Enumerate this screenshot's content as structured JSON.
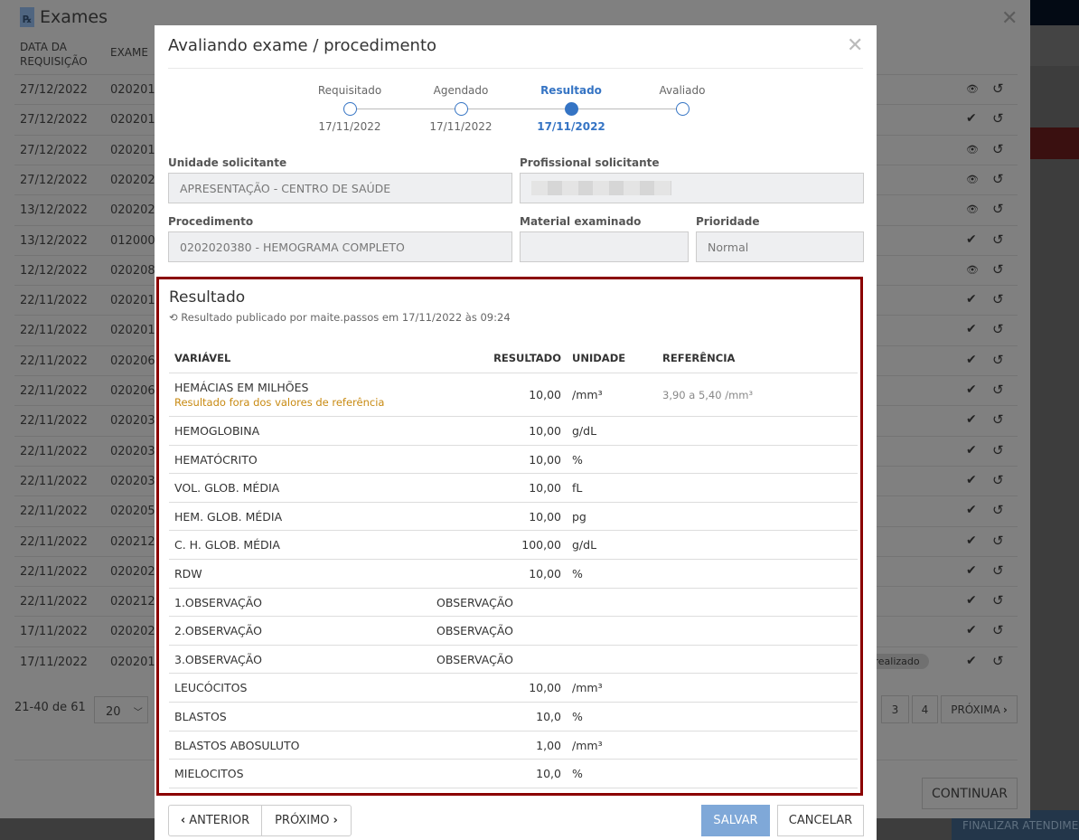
{
  "background": {
    "finalizar_label": "FINALIZAR ATENDIMENTO"
  },
  "exames": {
    "title": "Exames",
    "columns": [
      "DATA DA REQUISIÇÃO",
      "EXAME"
    ],
    "col_date_line1": "DATA DA",
    "col_date_line2": "REQUISIÇÃO",
    "rows": [
      {
        "date": "27/12/2022",
        "code": "020201",
        "action": "eye-icon"
      },
      {
        "date": "27/12/2022",
        "code": "020201",
        "action": "check-icon"
      },
      {
        "date": "27/12/2022",
        "code": "020201",
        "action": "eye-icon"
      },
      {
        "date": "27/12/2022",
        "code": "020202",
        "action": "eye-icon"
      },
      {
        "date": "13/12/2022",
        "code": "020202",
        "action": "eye-icon"
      },
      {
        "date": "13/12/2022",
        "code": "012000",
        "action": "check-icon"
      },
      {
        "date": "12/12/2022",
        "code": "020208",
        "action": "eye-icon"
      },
      {
        "date": "22/11/2022",
        "code": "020201",
        "action": "check-icon"
      },
      {
        "date": "22/11/2022",
        "code": "020201",
        "action": "check-icon"
      },
      {
        "date": "22/11/2022",
        "code": "020206",
        "action": "check-icon"
      },
      {
        "date": "22/11/2022",
        "code": "020206",
        "action": "check-icon"
      },
      {
        "date": "22/11/2022",
        "code": "020203",
        "action": "check-icon"
      },
      {
        "date": "22/11/2022",
        "code": "020203",
        "action": "check-icon"
      },
      {
        "date": "22/11/2022",
        "code": "020203",
        "action": "check-icon"
      },
      {
        "date": "22/11/2022",
        "code": "020205",
        "action": "check-icon"
      },
      {
        "date": "22/11/2022",
        "code": "020212",
        "action": "check-icon"
      },
      {
        "date": "22/11/2022",
        "code": "020202",
        "action": "check-icon"
      },
      {
        "date": "22/11/2022",
        "code": "020212",
        "action": "check-icon"
      },
      {
        "date": "17/11/2022",
        "code": "020202",
        "action": "check-icon"
      },
      {
        "date": "17/11/2022",
        "code": "020201",
        "action": "check-icon",
        "badge": "nto realizado"
      }
    ],
    "pagination": {
      "count": "21-40 de 61",
      "page_size": "20",
      "pages": [
        "3",
        "4"
      ],
      "next": "PRÓXIMA"
    },
    "continue_label": "CONTINUAR"
  },
  "modal": {
    "title": "Avaliando exame / procedimento",
    "steps": [
      {
        "label": "Requisitado",
        "date": "17/11/2022",
        "state": "done"
      },
      {
        "label": "Agendado",
        "date": "17/11/2022",
        "state": "done"
      },
      {
        "label": "Resultado",
        "date": "17/11/2022",
        "state": "active"
      },
      {
        "label": "Avaliado",
        "date": "",
        "state": "pending"
      }
    ],
    "fields": {
      "unidade": {
        "label": "Unidade solicitante",
        "value": "APRESENTAÇÃO - CENTRO DE SAÚDE"
      },
      "profissional": {
        "label": "Profissional solicitante",
        "value": ""
      },
      "procedimento": {
        "label": "Procedimento",
        "value": "0202020380 - HEMOGRAMA COMPLETO"
      },
      "material": {
        "label": "Material examinado",
        "value": ""
      },
      "prioridade": {
        "label": "Prioridade",
        "value": "Normal"
      }
    },
    "result": {
      "title": "Resultado",
      "published": "Resultado publicado por maite.passos em 17/11/2022 às 09:24",
      "headers": {
        "variavel": "VARIÁVEL",
        "resultado": "RESULTADO",
        "unidade": "UNIDADE",
        "referencia": "REFERÊNCIA"
      },
      "rows": [
        {
          "name": "HEMÁCIAS EM MILHÕES",
          "warning": "Resultado fora dos valores de referência",
          "value": "10,00",
          "unit": "/mm³",
          "ref": "3,90 a 5,40 /mm³"
        },
        {
          "name": "HEMOGLOBINA",
          "value": "10,00",
          "unit": "g/dL"
        },
        {
          "name": "HEMATÓCRITO",
          "value": "10,00",
          "unit": "%"
        },
        {
          "name": "VOL. GLOB. MÉDIA",
          "value": "10,00",
          "unit": "fL"
        },
        {
          "name": "HEM. GLOB. MÉDIA",
          "value": "10,00",
          "unit": "pg"
        },
        {
          "name": "C. H. GLOB. MÉDIA",
          "value": "100,00",
          "unit": "g/dL"
        },
        {
          "name": "RDW",
          "value": "10,00",
          "unit": "%"
        },
        {
          "name": "1.OBSERVAÇÃO",
          "obs": "OBSERVAÇÃO"
        },
        {
          "name": "2.OBSERVAÇÃO",
          "obs": "OBSERVAÇÃO"
        },
        {
          "name": "3.OBSERVAÇÃO",
          "obs": "OBSERVAÇÃO"
        },
        {
          "name": "LEUCÓCITOS",
          "value": "10,00",
          "unit": "/mm³"
        },
        {
          "name": "BLASTOS",
          "value": "10,0",
          "unit": "%"
        },
        {
          "name": "BLASTOS ABOSULUTO",
          "value": "1,00",
          "unit": "/mm³"
        },
        {
          "name": "MIELOCITOS",
          "value": "10,0",
          "unit": "%"
        }
      ]
    },
    "buttons": {
      "anterior": "ANTERIOR",
      "proximo": "PRÓXIMO",
      "salvar": "SALVAR",
      "cancelar": "CANCELAR"
    },
    "colors": {
      "accent": "#3574c4",
      "highlight_border": "#8b0000",
      "warning": "#c88a12",
      "save": "#7fa8d8"
    }
  }
}
